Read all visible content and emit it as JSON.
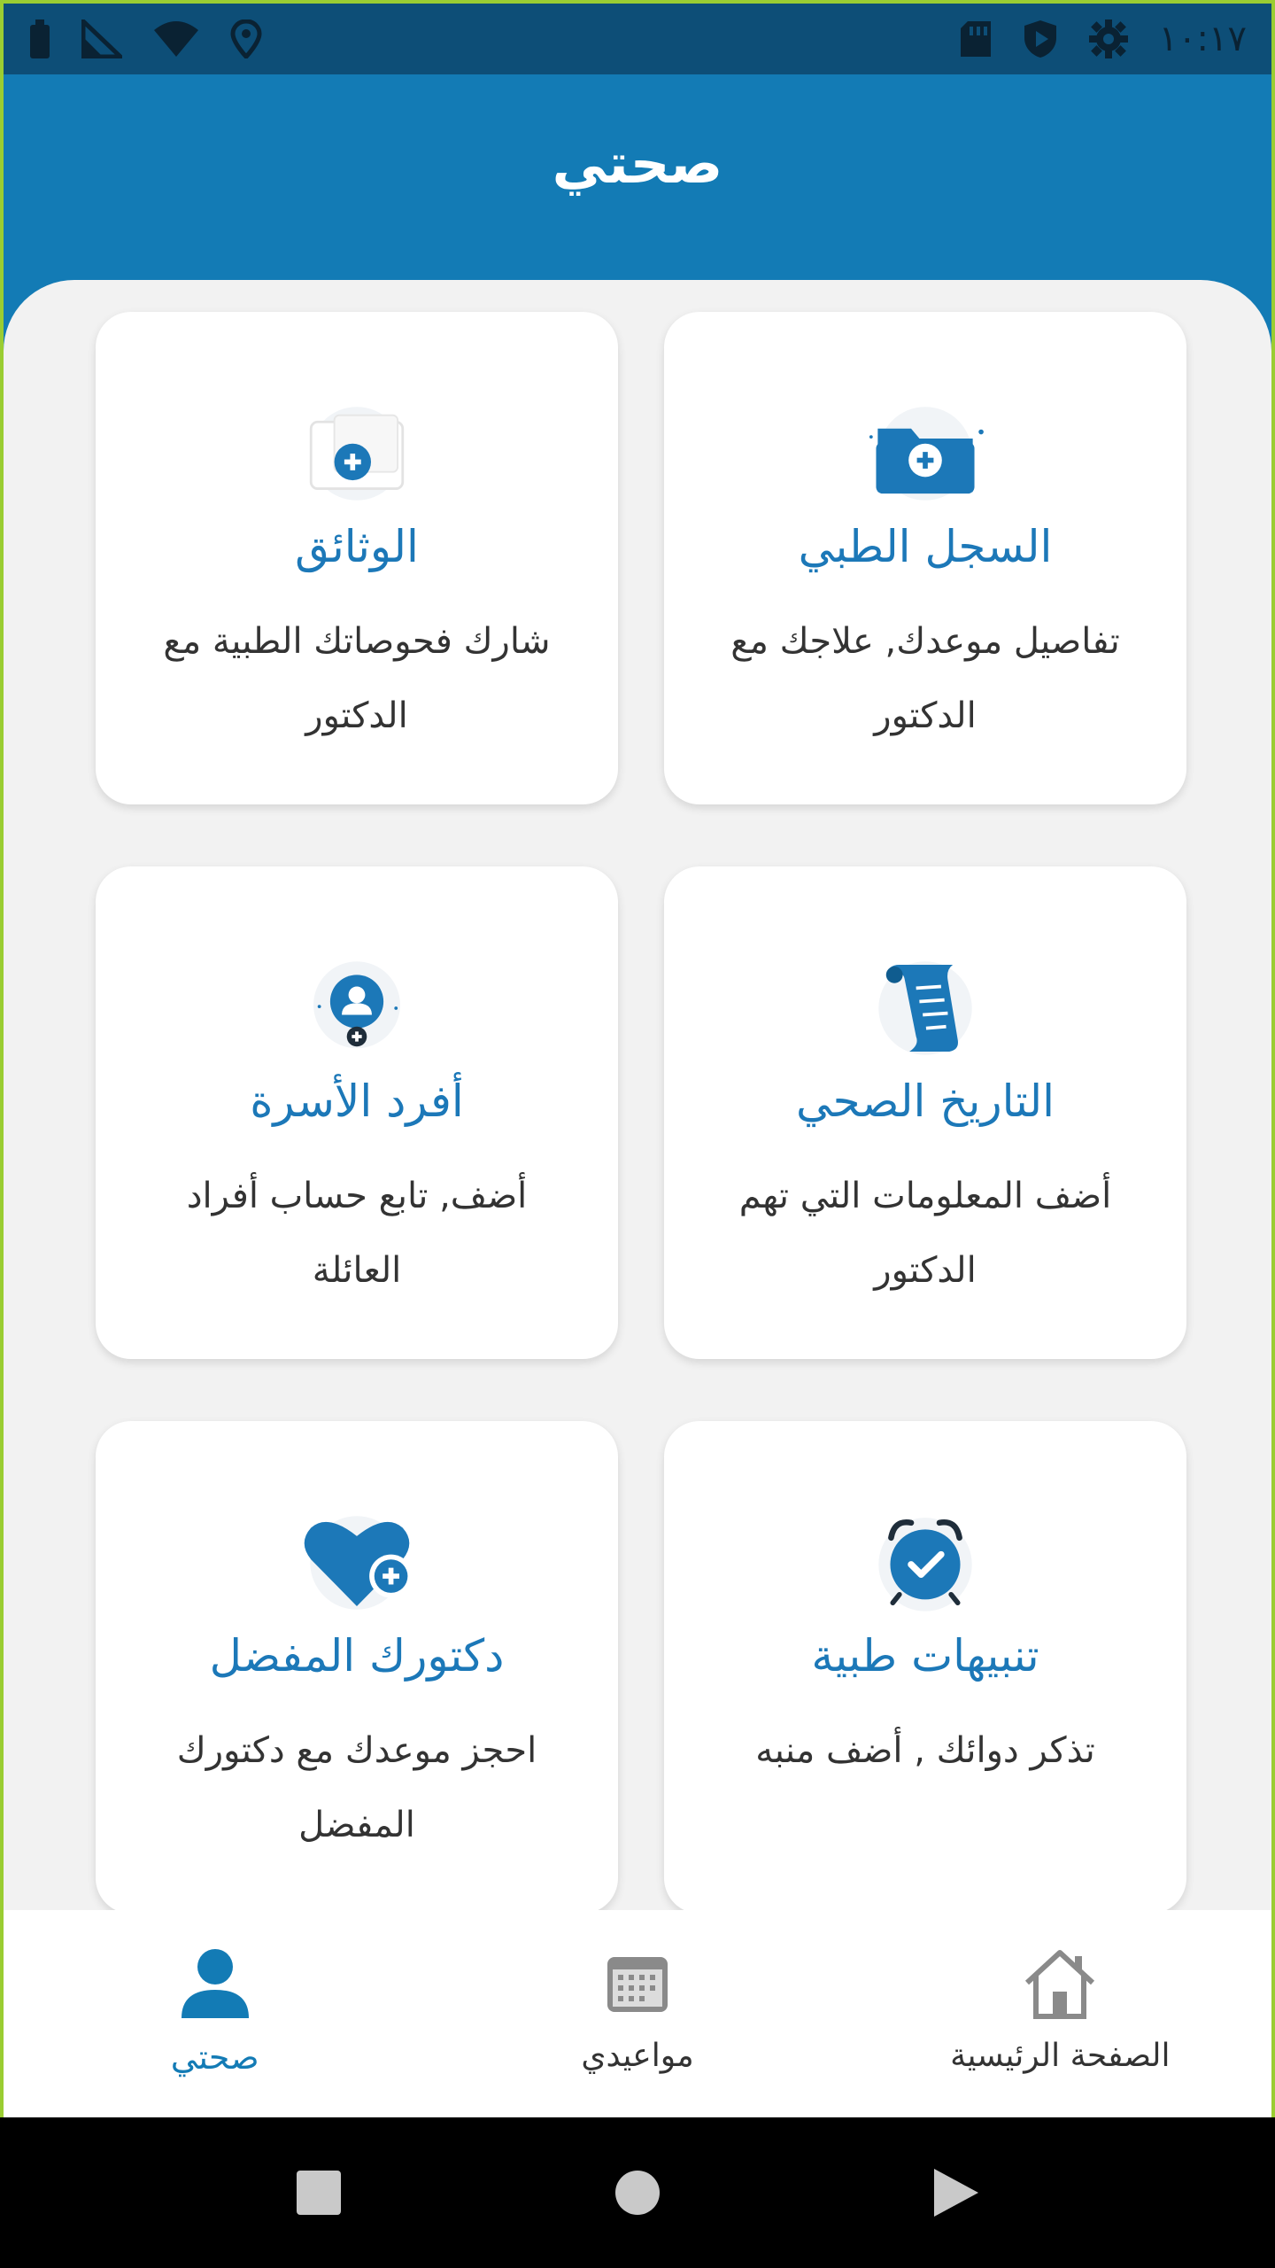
{
  "status_bar": {
    "time": "١٠:١٧",
    "icons": [
      "battery-icon",
      "signal-icon",
      "wifi-icon",
      "location-icon",
      "sd-card-icon",
      "shield-icon",
      "gear-icon"
    ]
  },
  "header": {
    "title": "صحتي"
  },
  "cards": [
    {
      "title": "السجل الطبي",
      "desc": "تفاصيل موعدك, علاجك مع الدكتور",
      "icon": "folder-add-icon"
    },
    {
      "title": "الوثائق",
      "desc": "شارك فحوصاتك الطبية مع الدكتور",
      "icon": "document-add-icon"
    },
    {
      "title": "التاريخ الصحي",
      "desc": "أضف المعلومات التي تهم الدكتور",
      "icon": "scroll-icon"
    },
    {
      "title": "أفرد الأسرة",
      "desc": "أضف, تابع حساب أفراد العائلة",
      "icon": "family-add-icon"
    },
    {
      "title": "تنبيهات طبية",
      "desc": "تذكر دوائك , أضف منبه",
      "icon": "alarm-icon"
    },
    {
      "title": "دكتورك المفضل",
      "desc": "احجز موعدك مع دكتورك المفضل",
      "icon": "heart-add-icon"
    }
  ],
  "bottom_nav": {
    "home_label": "الصفحة الرئيسية",
    "appointments_label": "مواعيدي",
    "my_health_label": "صحتي",
    "active": "my_health"
  },
  "colors": {
    "status_bar": "#0d4e77",
    "header": "#137bb5",
    "accent": "#1c78b8",
    "background": "#f2f2f2"
  }
}
